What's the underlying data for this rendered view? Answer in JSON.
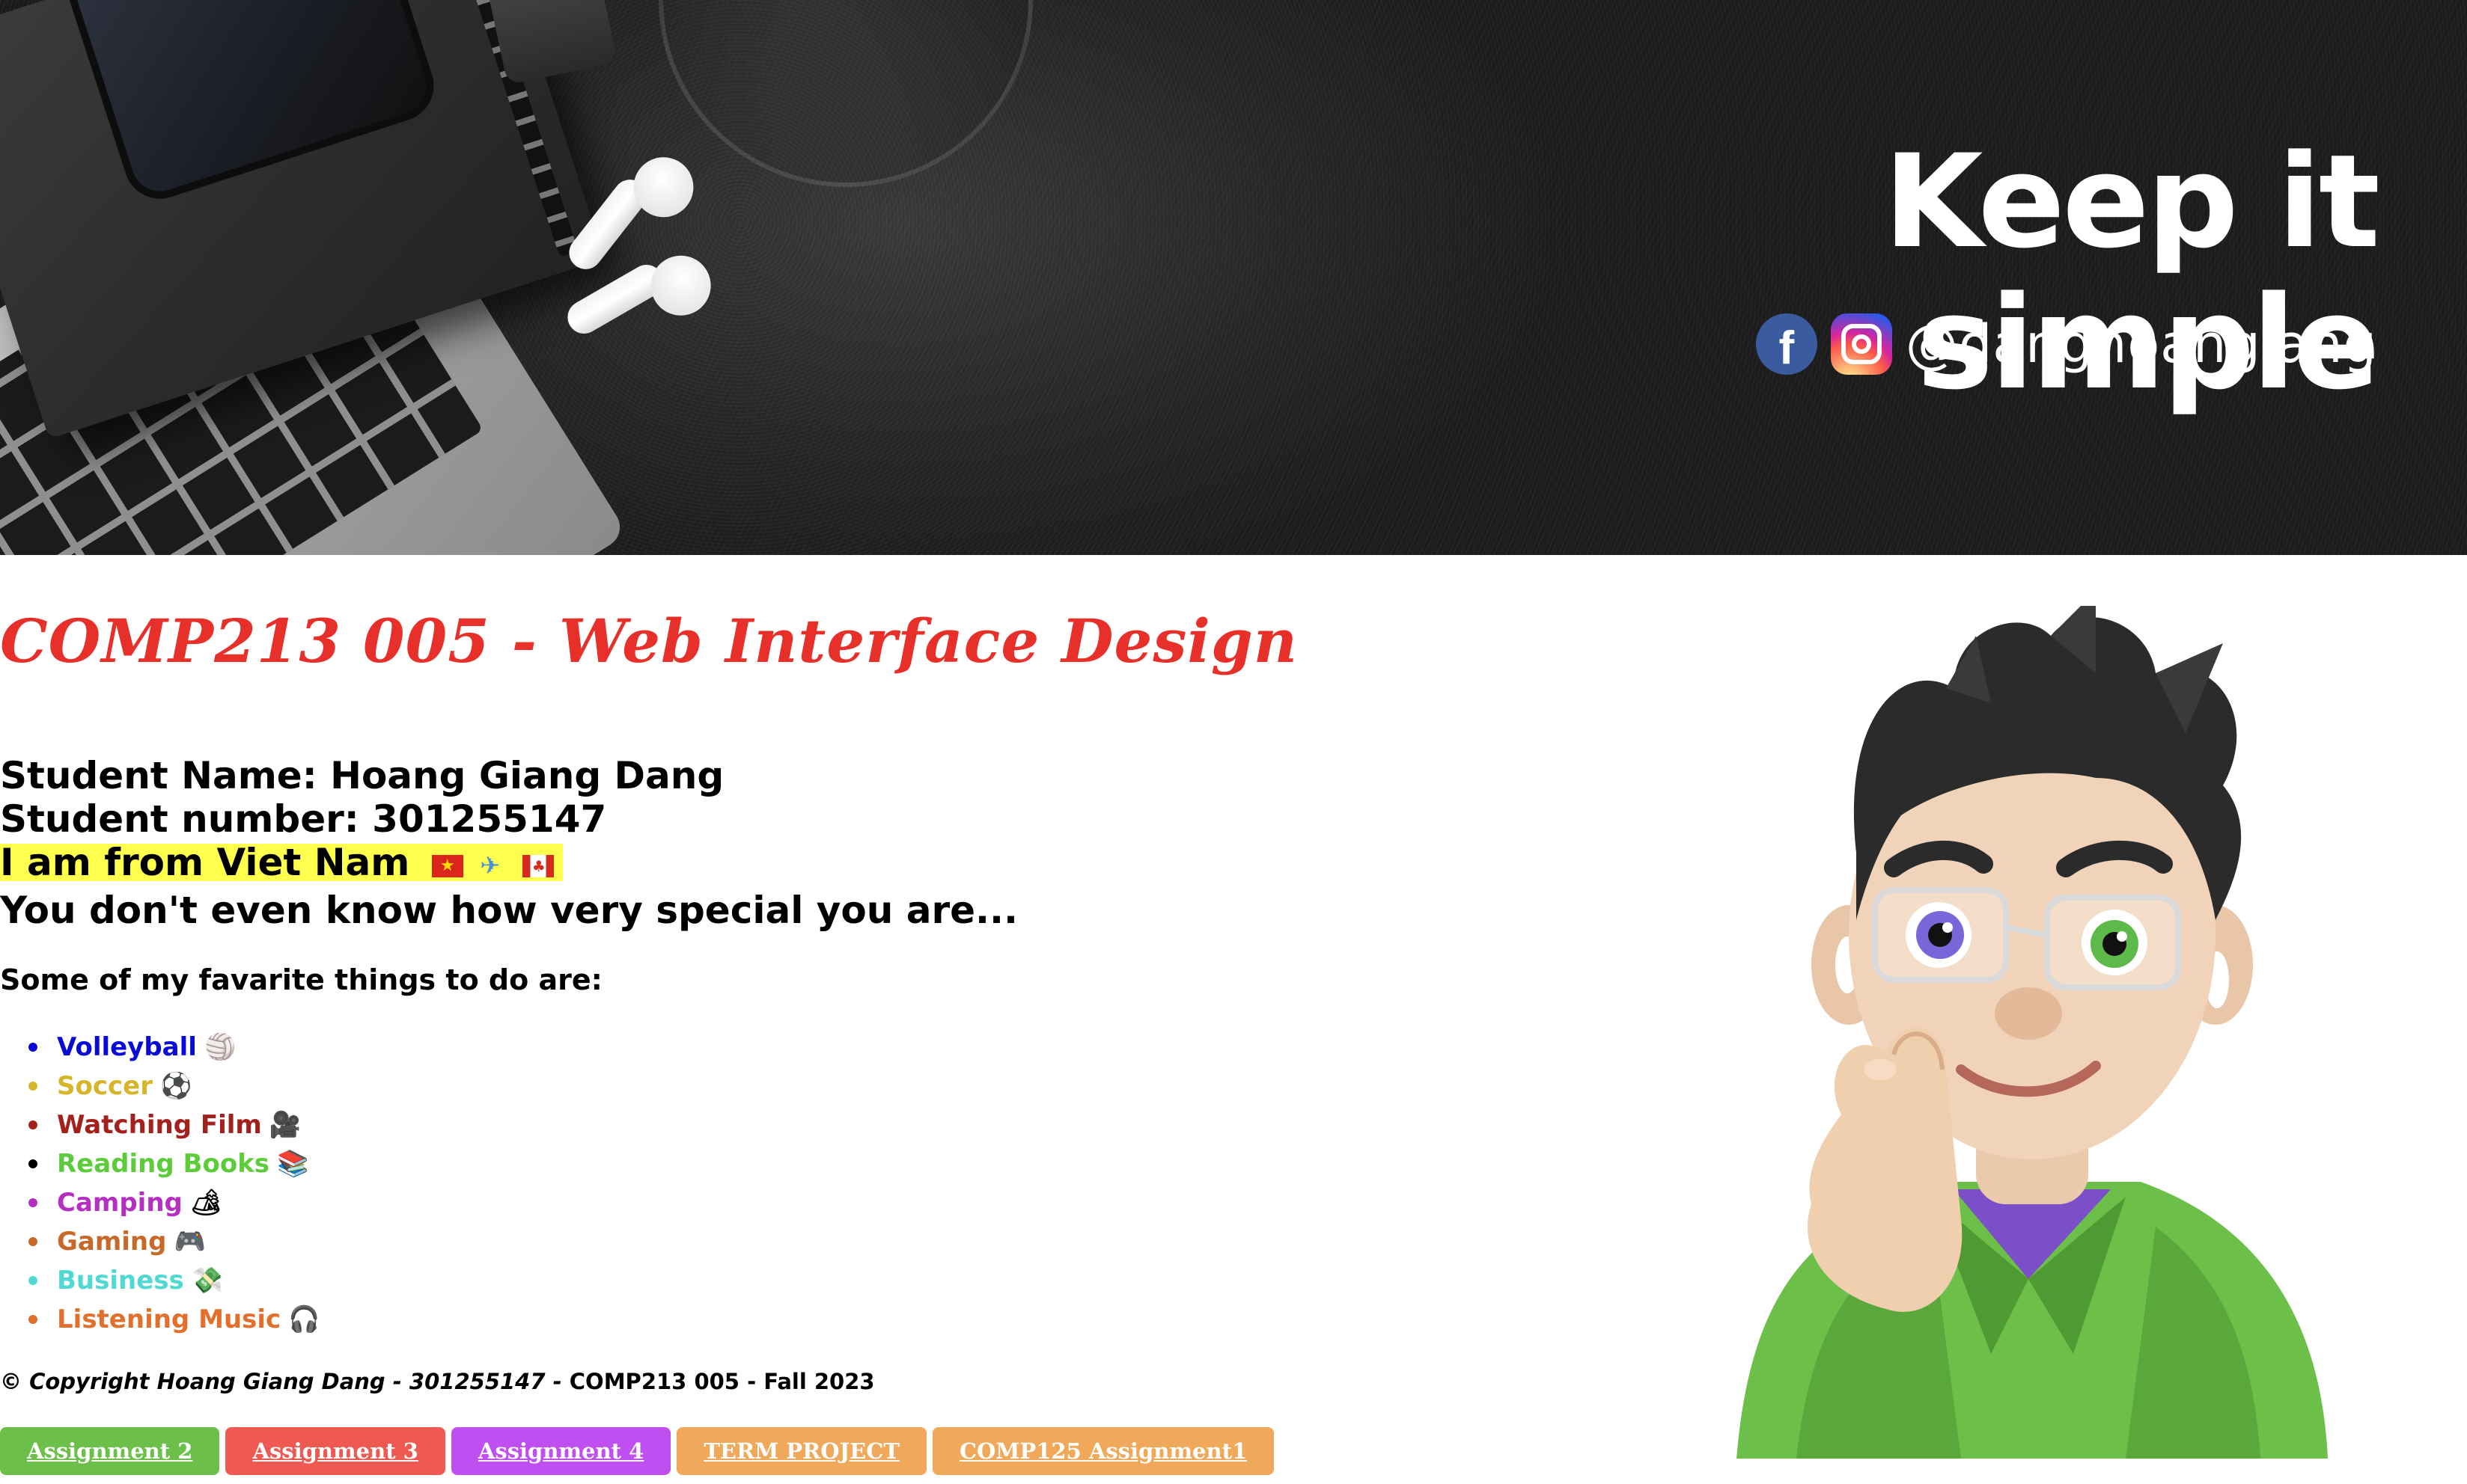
{
  "banner": {
    "title": "Keep it simple",
    "handle": "@danghoangiang",
    "icons": [
      "facebook-icon",
      "instagram-icon"
    ]
  },
  "course_title": "COMP213 005 - Web Interface Design",
  "student": {
    "name_line": "Student Name: Hoang Giang Dang",
    "number_line": "Student number: 301255147",
    "origin_line": "I am from Viet Nam",
    "origin_emojis": [
      "vietnam-flag",
      "airplane",
      "canada-flag"
    ],
    "special_line": "You don't even know how very special you are..."
  },
  "favorites": {
    "heading": "Some of my favarite things to do are:",
    "items": [
      {
        "label": "Volleyball",
        "emoji": "🏐",
        "color": "#0a0ad6"
      },
      {
        "label": "Soccer",
        "emoji": "⚽",
        "color": "#d7b52a"
      },
      {
        "label": "Watching Film",
        "emoji": "🎥",
        "color": "#a3201c"
      },
      {
        "label": "Reading Books",
        "emoji": "📚",
        "color": "#5ccc3a"
      },
      {
        "label": "Camping",
        "emoji": "🏕",
        "color": "#b52fc0"
      },
      {
        "label": "Gaming",
        "emoji": "🎮",
        "color": "#c8692a"
      },
      {
        "label": "Business",
        "emoji": "💸",
        "color": "#4fd9d2"
      },
      {
        "label": "Listening Music",
        "emoji": "🎧",
        "color": "#e0702c"
      }
    ],
    "bullet_colors": [
      "#0a0ad6",
      "#d7b52a",
      "#a3201c",
      "#000000",
      "#b52fc0",
      "#c8692a",
      "#4fd9d2",
      "#e0702c"
    ]
  },
  "copyright": {
    "italic_part": "© Copyright Hoang Giang Dang - 301255147 -",
    "plain_part": " COMP213 005 - Fall 2023"
  },
  "nav_buttons": [
    {
      "label": "Assignment 2",
      "color": "#6cc04a"
    },
    {
      "label": "Assignment 3",
      "color": "#ee5a52"
    },
    {
      "label": "Assignment 4",
      "color": "#bf4ff0"
    },
    {
      "label": "TERM PROJECT",
      "color": "#f0a95a"
    },
    {
      "label": "COMP125 Assignment1",
      "color": "#f0a95a"
    }
  ],
  "colors": {
    "title_red": "#e8302a",
    "highlight_yellow": "#ffff4d"
  }
}
